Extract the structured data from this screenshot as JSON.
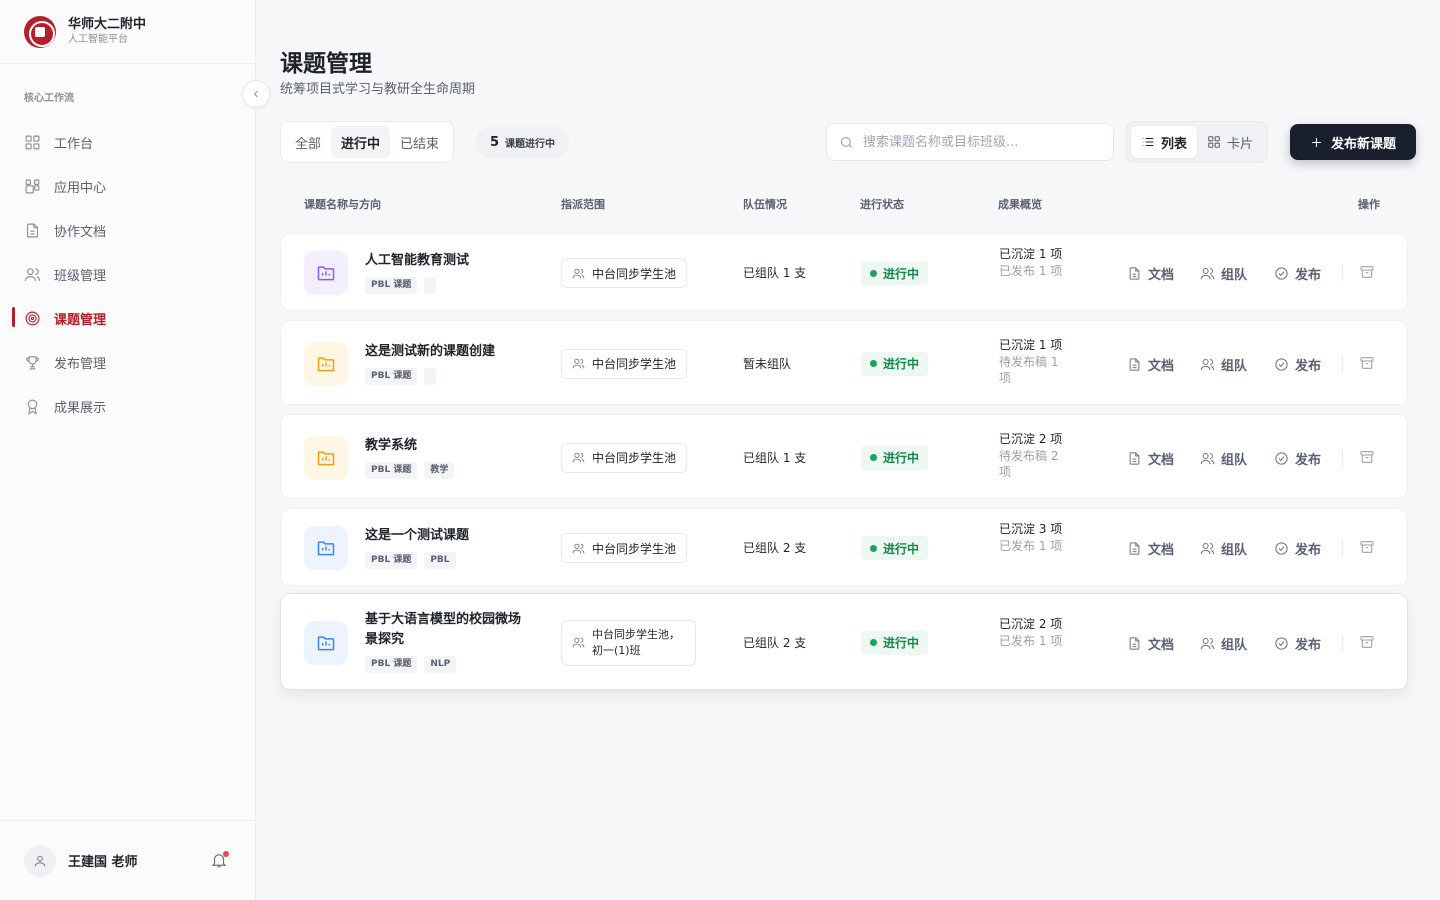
{
  "brand": {
    "name": "华师大二附中",
    "subtitle": "人工智能平台"
  },
  "sidebar": {
    "section_label": "核心工作流",
    "items": [
      {
        "label": "工作台",
        "icon": "dashboard-icon"
      },
      {
        "label": "应用中心",
        "icon": "apps-icon"
      },
      {
        "label": "协作文档",
        "icon": "document-icon"
      },
      {
        "label": "班级管理",
        "icon": "users-icon"
      },
      {
        "label": "课题管理",
        "icon": "target-icon",
        "active": true
      },
      {
        "label": "发布管理",
        "icon": "trophy-icon"
      },
      {
        "label": "成果展示",
        "icon": "award-icon"
      }
    ]
  },
  "user": {
    "name": "王建国 老师"
  },
  "page": {
    "title": "课题管理",
    "subtitle": "统筹项目式学习与教研全生命周期"
  },
  "filters": {
    "all": "全部",
    "active": "进行中",
    "ended": "已结束",
    "selected": "进行中"
  },
  "count": {
    "number": "5",
    "label": "课题进行中"
  },
  "search": {
    "placeholder": "搜索课题名称或目标班级...",
    "value": ""
  },
  "view": {
    "list": "列表",
    "card": "卡片",
    "selected": "列表"
  },
  "publish_button": "发布新课题",
  "table": {
    "headers": {
      "name": "课题名称与方向",
      "scope": "指派范围",
      "team": "队伍情况",
      "status": "进行状态",
      "results": "成果概览",
      "actions": "操作"
    },
    "action_labels": {
      "docs": "文档",
      "team": "组队",
      "publish": "发布"
    },
    "rows": [
      {
        "name": "人工智能教育测试",
        "tags": [
          "PBL 课题",
          ""
        ],
        "scope": "中台同步学生池",
        "team": "已组队 1 支",
        "status": "进行中",
        "result_line1": "已沉淀 1 项",
        "result_line2": "已发布 1 项",
        "icon_color": "#8b5cf6",
        "icon_bg": "#f3efff"
      },
      {
        "name": "这是测试新的课题创建",
        "tags": [
          "PBL 课题",
          ""
        ],
        "scope": "中台同步学生池",
        "team": "暂未组队",
        "status": "进行中",
        "result_line1": "已沉淀 1 项",
        "result_line2": "待发布稿 1 项",
        "icon_color": "#f59e0b",
        "icon_bg": "#fff7e6"
      },
      {
        "name": "教学系统",
        "tags": [
          "PBL 课题",
          "教学"
        ],
        "scope": "中台同步学生池",
        "team": "已组队 1 支",
        "status": "进行中",
        "result_line1": "已沉淀 2 项",
        "result_line2": "待发布稿 2 项",
        "icon_color": "#f59e0b",
        "icon_bg": "#fff7e6"
      },
      {
        "name": "这是一个测试课题",
        "tags": [
          "PBL 课题",
          "PBL"
        ],
        "scope": "中台同步学生池",
        "team": "已组队 2 支",
        "status": "进行中",
        "result_line1": "已沉淀 3 项",
        "result_line2": "已发布 1 项",
        "icon_color": "#3b82f6",
        "icon_bg": "#eef4ff"
      },
      {
        "name": "基于大语言模型的校园微场景探究",
        "tags": [
          "PBL 课题",
          "NLP"
        ],
        "scope": "中台同步学生池，初一(1)班",
        "team": "已组队 2 支",
        "status": "进行中",
        "result_line1": "已沉淀 2 项",
        "result_line2": "已发布 1 项",
        "icon_color": "#3b82f6",
        "icon_bg": "#eef4ff"
      }
    ]
  }
}
